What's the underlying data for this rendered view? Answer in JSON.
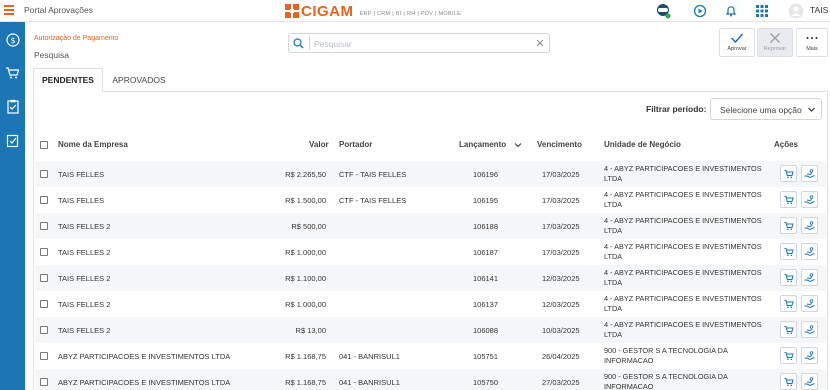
{
  "app": {
    "portal_title": "Portal Aprovações",
    "logo_text": "CIGAM",
    "logo_sub": "ERP | CRM | BI | RH | PDV | MOBILE",
    "user_name": "TAIS",
    "accent_color": "#e8631e",
    "sidebar_color": "#1c75b4"
  },
  "page": {
    "breadcrumb": "Autorização de Pagamento",
    "title": "Pesquisa",
    "search_placeholder": "Pesquisar",
    "search_value": ""
  },
  "actions": {
    "approve": "Aprovar",
    "reject": "Reprovar",
    "more": "Mais"
  },
  "tabs": [
    {
      "label": "PENDENTES",
      "active": true
    },
    {
      "label": "APROVADOS",
      "active": false
    }
  ],
  "filter": {
    "label": "Filtrar período:",
    "selected": "Selecione uma opção"
  },
  "table": {
    "headers": {
      "company": "Nome da Empresa",
      "value": "Valor",
      "bearer": "Portador",
      "launch": "Lançamento",
      "due": "Vencimento",
      "unit": "Unidade de Negócio",
      "actions": "Ações"
    },
    "rows": [
      {
        "company": "TAIS FELLES",
        "value": "R$ 2.265,50",
        "bearer": "CTF - TAIS FELLES",
        "launch": "106196",
        "due": "17/03/2025",
        "unit": "4 - ABYZ PARTICIPACOES E INVESTIMENTOS LTDA"
      },
      {
        "company": "TAIS FELLES",
        "value": "R$ 1.500,00",
        "bearer": "CTF - TAIS FELLES",
        "launch": "106195",
        "due": "17/03/2025",
        "unit": "4 - ABYZ PARTICIPACOES E INVESTIMENTOS LTDA"
      },
      {
        "company": "TAIS FELLES 2",
        "value": "R$ 500,00",
        "bearer": "",
        "launch": "106188",
        "due": "17/03/2025",
        "unit": "4 - ABYZ PARTICIPACOES E INVESTIMENTOS LTDA"
      },
      {
        "company": "TAIS FELLES 2",
        "value": "R$ 1.000,00",
        "bearer": "",
        "launch": "106187",
        "due": "17/03/2025",
        "unit": "4 - ABYZ PARTICIPACOES E INVESTIMENTOS LTDA"
      },
      {
        "company": "TAIS FELLES 2",
        "value": "R$ 1.100,00",
        "bearer": "",
        "launch": "106141",
        "due": "12/03/2025",
        "unit": "4 - ABYZ PARTICIPACOES E INVESTIMENTOS LTDA"
      },
      {
        "company": "TAIS FELLES 2",
        "value": "R$ 1.000,00",
        "bearer": "",
        "launch": "106137",
        "due": "12/03/2025",
        "unit": "4 - ABYZ PARTICIPACOES E INVESTIMENTOS LTDA"
      },
      {
        "company": "TAIS FELLES 2",
        "value": "R$ 13,00",
        "bearer": "",
        "launch": "106088",
        "due": "10/03/2025",
        "unit": "4 - ABYZ PARTICIPACOES E INVESTIMENTOS LTDA"
      },
      {
        "company": "ABYZ PARTICIPACOES E INVESTIMENTOS LTDA",
        "value": "R$ 1.168,75",
        "bearer": "041 - BANRISUL1",
        "launch": "105751",
        "due": "26/04/2025",
        "unit": "900 - GESTOR S A TECNOLOGIA DA INFORMACAO"
      },
      {
        "company": "ABYZ PARTICIPACOES E INVESTIMENTOS LTDA",
        "value": "R$ 1.168,75",
        "bearer": "041 - BANRISUL1",
        "launch": "105750",
        "due": "27/03/2025",
        "unit": "900 - GESTOR S A TECNOLOGIA DA INFORMACAO"
      }
    ]
  }
}
